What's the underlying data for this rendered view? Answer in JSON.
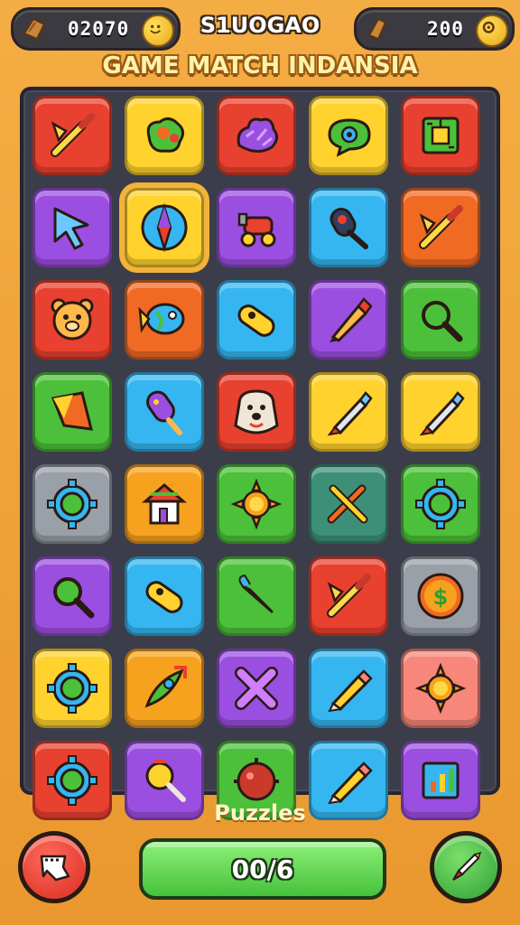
{
  "header": {
    "left_counter": "02070",
    "center_label": "S1UOGAO",
    "right_counter": "200",
    "title": "GAME MATCH INDANSIA"
  },
  "board": {
    "tiles": [
      {
        "color": "#e8412f",
        "icon": "dart-icon"
      },
      {
        "color": "#ffd22e",
        "icon": "blob-icon"
      },
      {
        "color": "#e8412f",
        "icon": "coral-icon"
      },
      {
        "color": "#ffd22e",
        "icon": "speech-eye-icon"
      },
      {
        "color": "#e8412f",
        "icon": "circuit-icon"
      },
      {
        "color": "#9b4fe0",
        "icon": "arrow-cursor-icon"
      },
      {
        "color": "#ffd22e",
        "icon": "compass-icon",
        "selected": true
      },
      {
        "color": "#9b4fe0",
        "icon": "cannon-icon"
      },
      {
        "color": "#35b6f0",
        "icon": "probe-icon"
      },
      {
        "color": "#f06a24",
        "icon": "dart-icon"
      },
      {
        "color": "#e8412f",
        "icon": "bear-icon"
      },
      {
        "color": "#f06a24",
        "icon": "fish-icon"
      },
      {
        "color": "#35b6f0",
        "icon": "capsule-icon"
      },
      {
        "color": "#9b4fe0",
        "icon": "crayon-icon"
      },
      {
        "color": "#4cc03a",
        "icon": "magnifier-icon"
      },
      {
        "color": "#4cc03a",
        "icon": "flag-icon"
      },
      {
        "color": "#35b6f0",
        "icon": "popsicle-icon"
      },
      {
        "color": "#e8412f",
        "icon": "dog-icon"
      },
      {
        "color": "#ffd22e",
        "icon": "pen-icon"
      },
      {
        "color": "#ffd22e",
        "icon": "pen-icon"
      },
      {
        "color": "#9aa0a8",
        "icon": "gear-icon"
      },
      {
        "color": "#f7a21e",
        "icon": "house-icon"
      },
      {
        "color": "#4cc03a",
        "icon": "sun-icon"
      },
      {
        "color": "#3e8f78",
        "icon": "crossed-pens-icon"
      },
      {
        "color": "#4cc03a",
        "icon": "gear-icon"
      },
      {
        "color": "#9b4fe0",
        "icon": "magnifier-icon"
      },
      {
        "color": "#35b6f0",
        "icon": "capsule-icon"
      },
      {
        "color": "#4cc03a",
        "icon": "carrot-icon"
      },
      {
        "color": "#e8412f",
        "icon": "dart-icon"
      },
      {
        "color": "#9aa0a8",
        "icon": "coin-icon"
      },
      {
        "color": "#ffd22e",
        "icon": "gear-icon"
      },
      {
        "color": "#f7a21e",
        "icon": "rocket-icon"
      },
      {
        "color": "#9b4fe0",
        "icon": "cross-icon"
      },
      {
        "color": "#35b6f0",
        "icon": "pencil-icon"
      },
      {
        "color": "#f7877a",
        "icon": "sun-icon"
      },
      {
        "color": "#e8412f",
        "icon": "gear-icon"
      },
      {
        "color": "#9b4fe0",
        "icon": "lollipop-icon"
      },
      {
        "color": "#4cc03a",
        "icon": "ball-icon"
      },
      {
        "color": "#35b6f0",
        "icon": "pencil-icon"
      },
      {
        "color": "#9b4fe0",
        "icon": "chart-box-icon"
      }
    ]
  },
  "footer": {
    "label": "Puzzles",
    "progress_text": "00/6",
    "progress_fill": 1.0,
    "left_button_icon": "broken-tile-icon",
    "right_button_icon": "dart-icon"
  }
}
